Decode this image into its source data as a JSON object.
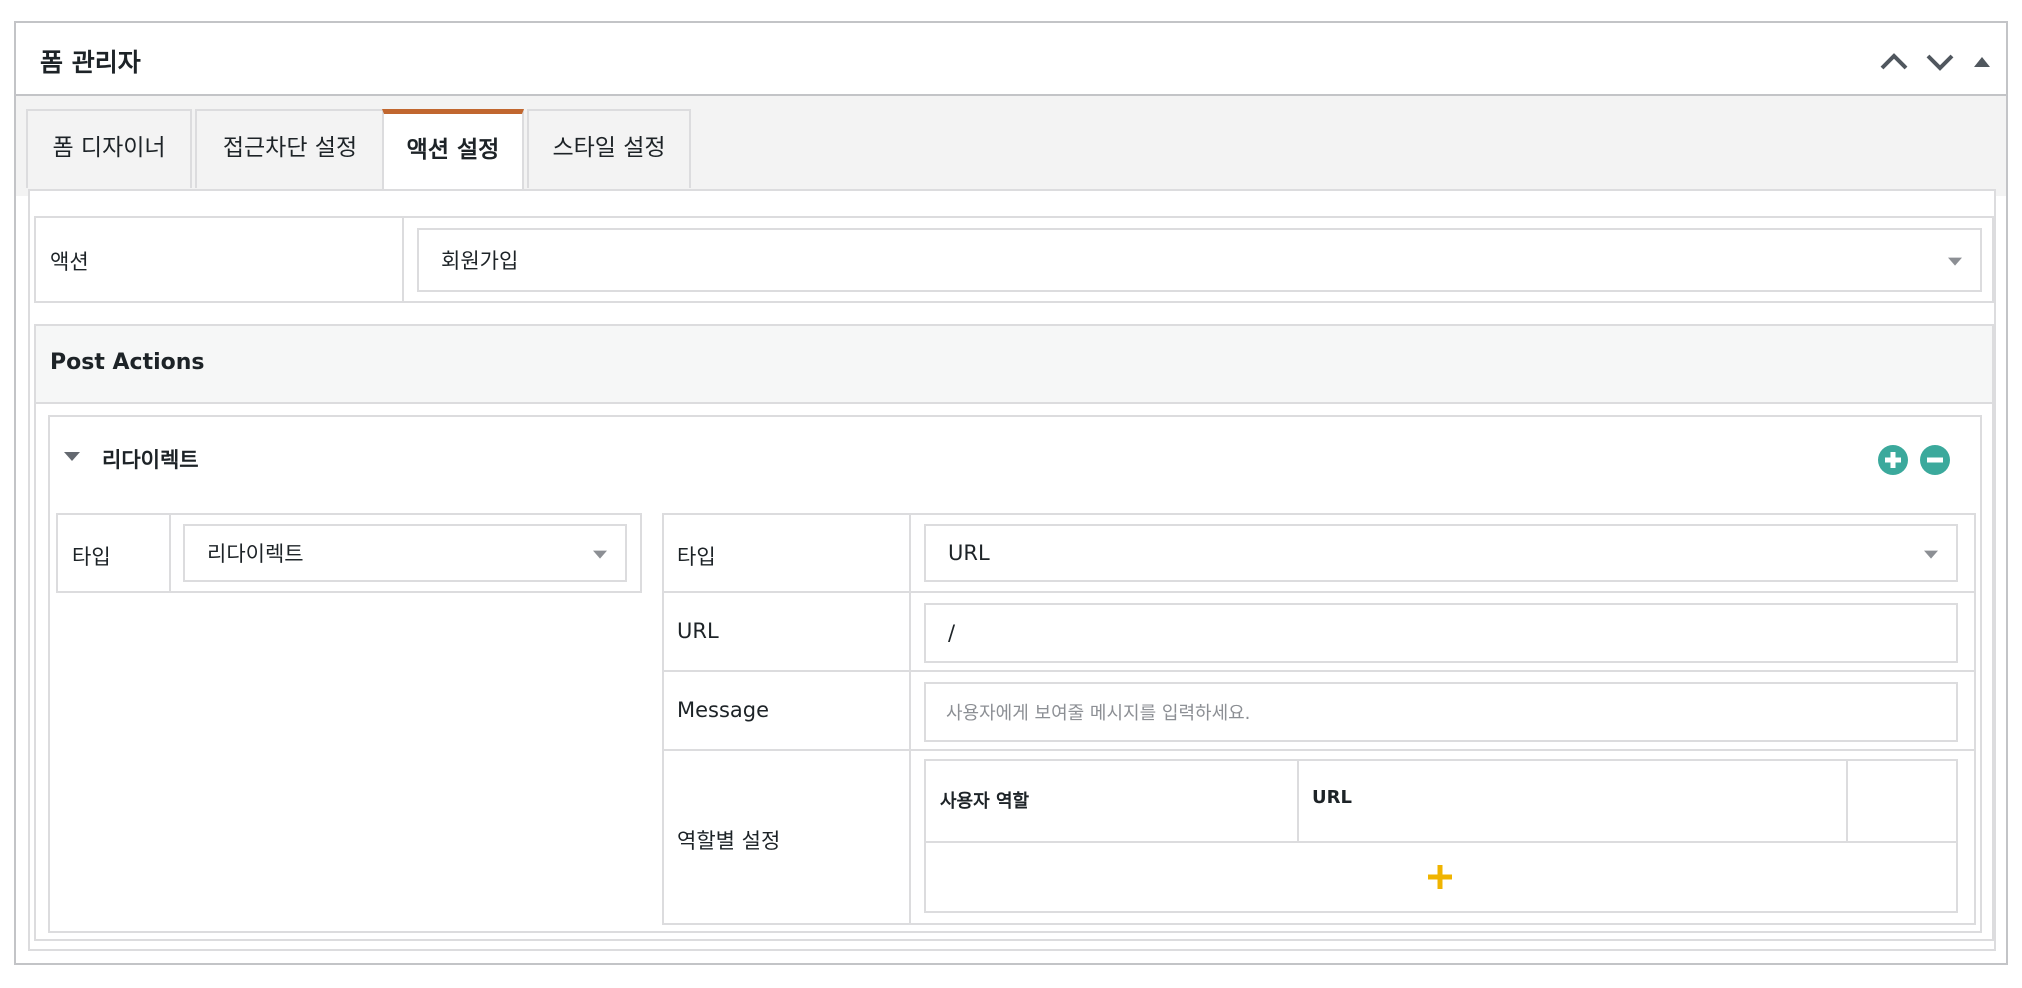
{
  "panel": {
    "title": "폼 관리자",
    "controls": [
      "chevron-up-icon",
      "chevron-down-icon",
      "triangle-up-icon"
    ]
  },
  "tabs": [
    {
      "label": "폼 디자이너",
      "active": false
    },
    {
      "label": "접근차단 설정",
      "active": false
    },
    {
      "label": "액션 설정",
      "active": true
    },
    {
      "label": "스타일 설정",
      "active": false
    }
  ],
  "action": {
    "label": "액션",
    "value": "회원가입"
  },
  "post_actions": {
    "title": "Post Actions",
    "redirect": {
      "title": "리다이렉트",
      "type_label": "타입",
      "type_value": "리다이렉트",
      "settings": {
        "type_label": "타입",
        "type_value": "URL",
        "url_label": "URL",
        "url_value": "/",
        "message_label": "Message",
        "message_placeholder": "사용자에게 보여줄 메시지를 입력하세요.",
        "role_label": "역할별 설정",
        "role_table": {
          "col_role": "사용자 역할",
          "col_url": "URL"
        }
      }
    }
  },
  "colors": {
    "active_tab_accent": "#c1672f",
    "circle_button": "#3ba99c",
    "add_plus": "#f0b400",
    "border": "#dcdcde"
  }
}
